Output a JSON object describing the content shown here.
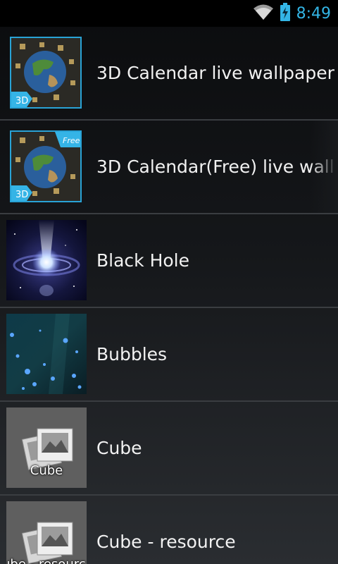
{
  "status_bar": {
    "time": "8:49",
    "icons": [
      "wifi-icon",
      "battery-charging-icon"
    ],
    "accent_color": "#33b5e5"
  },
  "wallpaper_list": {
    "items": [
      {
        "label": "3D Calendar live wallpaper",
        "thumb": "3d-calendar-earth",
        "badge": "3D"
      },
      {
        "label": "3D Calendar(Free) live wall",
        "thumb": "3d-calendar-earth-free",
        "badge": "3D",
        "corner_badge": "Free"
      },
      {
        "label": "Black Hole",
        "thumb": "black-hole"
      },
      {
        "label": "Bubbles",
        "thumb": "bubbles"
      },
      {
        "label": "Cube",
        "thumb": "placeholder-image",
        "caption": "Cube"
      },
      {
        "label": "Cube - resource",
        "thumb": "placeholder-image",
        "caption": "ube - resourc"
      }
    ]
  }
}
